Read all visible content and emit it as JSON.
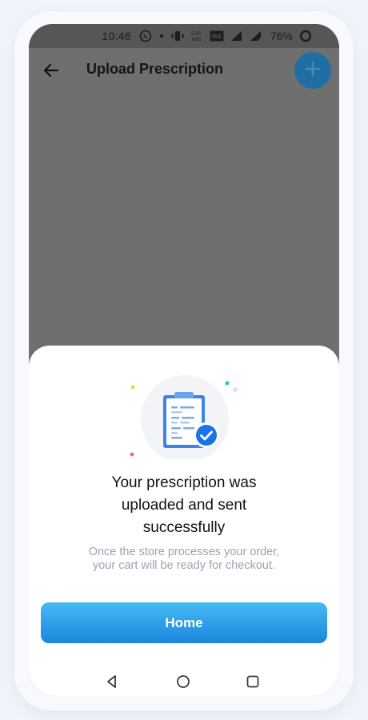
{
  "status_bar": {
    "time": "10:46",
    "battery": "76%",
    "icons": [
      "whatsapp-icon",
      "dot-icon",
      "vibrate-icon",
      "network-speed-icon",
      "volte-icon",
      "signal-icon",
      "signal-icon",
      "battery-ring-icon"
    ]
  },
  "header": {
    "title": "Upload Prescription",
    "back_icon": "arrow-left-icon",
    "add_icon": "plus-icon"
  },
  "sheet": {
    "illustration": "prescription-clipboard-check-icon",
    "title": "Your prescription was uploaded and sent successfully",
    "title_lines": [
      "Your prescription was",
      "uploaded and sent",
      "successfully"
    ],
    "subtitle_lines": [
      "Once the store processes your order,",
      "your cart will be ready for checkout."
    ],
    "home_button": "Home"
  },
  "nav_bar": {
    "buttons": [
      "back-triangle-icon",
      "home-circle-icon",
      "recents-square-icon"
    ]
  },
  "colors": {
    "accent": "#1b86de",
    "accent_light": "#46baf4",
    "overlay": "#6f6f6f",
    "subtitle": "#9aa3b4"
  }
}
